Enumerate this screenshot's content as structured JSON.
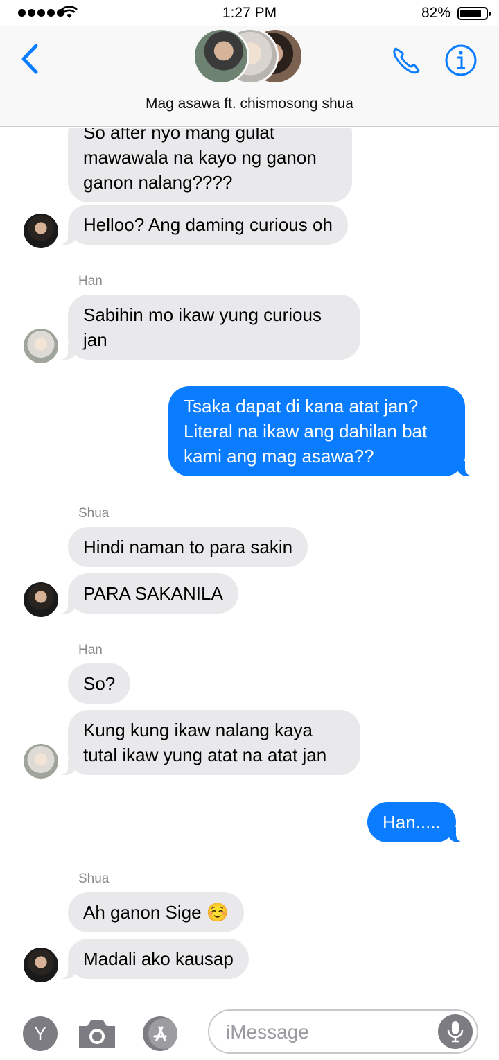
{
  "status_bar": {
    "time": "1:27 PM",
    "battery_percent": "82%",
    "battery_level": 0.82,
    "signal_bars": 5,
    "wifi_icon": "wifi-icon"
  },
  "header": {
    "title": "Mag asawa ft. chismosong shua",
    "back_icon": "chevron-left-icon",
    "call_icon": "phone-icon",
    "info_icon": "info-icon",
    "accent_color": "#0a7cff"
  },
  "messages": [
    {
      "direction": "incoming",
      "sender": "",
      "text_lines": [
        "So after nyo mang gulat",
        "mawawala na kayo ng ganon",
        "ganon nalang????"
      ]
    },
    {
      "direction": "incoming",
      "sender": "",
      "text": "Helloo? Ang daming curious oh",
      "avatar": "shua"
    },
    {
      "direction": "incoming",
      "sender": "Han",
      "text_lines": [
        "Sabihin mo ikaw yung curious",
        "jan"
      ],
      "avatar": "han"
    },
    {
      "direction": "outgoing",
      "text_lines": [
        "Tsaka dapat di kana atat jan?",
        "Literal na ikaw ang dahilan bat",
        "kami ang mag asawa??"
      ]
    },
    {
      "direction": "incoming",
      "sender": "Shua",
      "text": "Hindi naman to para sakin"
    },
    {
      "direction": "incoming",
      "sender": "",
      "text": "PARA SAKANILA",
      "avatar": "shua"
    },
    {
      "direction": "incoming",
      "sender": "Han",
      "text": "So?"
    },
    {
      "direction": "incoming",
      "sender": "",
      "text_lines": [
        "Kung kung ikaw nalang kaya",
        "tutal ikaw yung atat na atat jan"
      ],
      "avatar": "han"
    },
    {
      "direction": "outgoing",
      "text": "Han....."
    },
    {
      "direction": "incoming",
      "sender": "Shua",
      "text": "Ah ganon Sige ☺️"
    },
    {
      "direction": "incoming",
      "sender": "",
      "text": "Madali ako kausap",
      "avatar": "shua"
    }
  ],
  "input_bar": {
    "placeholder": "iMessage",
    "value": "",
    "left_button_label": "Y",
    "camera_icon": "camera-icon",
    "appstore_icon": "app-store-icon",
    "mic_icon": "microphone-icon"
  },
  "colors": {
    "incoming_bubble": "#e9e9eb",
    "outgoing_bubble": "#0a7cff",
    "sender_label": "#8a8a8e"
  }
}
